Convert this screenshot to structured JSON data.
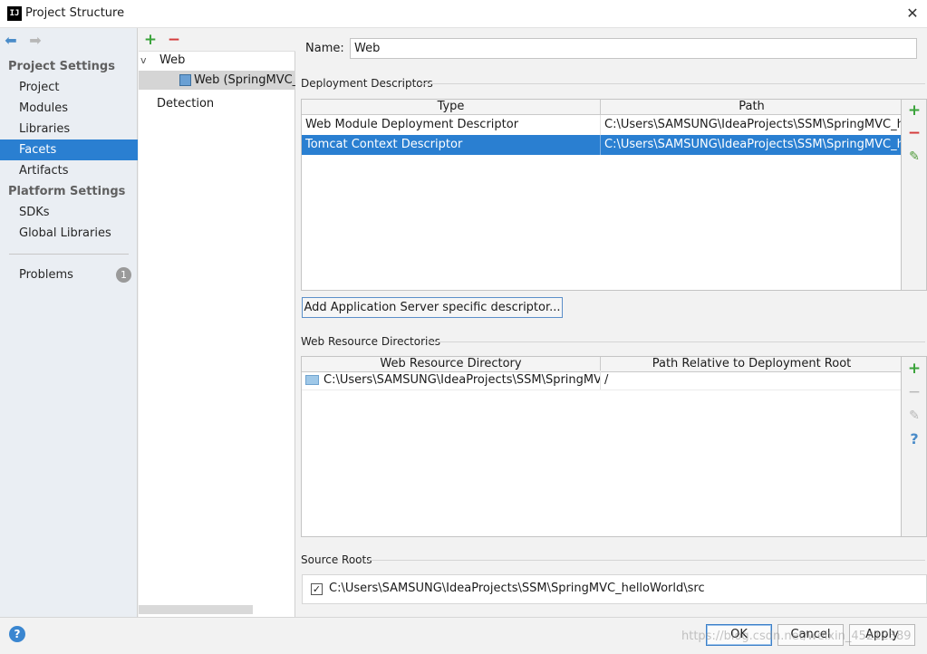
{
  "window": {
    "title": "Project Structure",
    "logo": "IJ",
    "close_glyph": "✕"
  },
  "sidebar": {
    "back_glyph": "⬅",
    "forward_glyph": "➡",
    "project_settings_header": "Project Settings",
    "platform_settings_header": "Platform Settings",
    "items": [
      {
        "label": "Project"
      },
      {
        "label": "Modules"
      },
      {
        "label": "Libraries"
      },
      {
        "label": "Facets",
        "selected": true
      },
      {
        "label": "Artifacts"
      },
      {
        "label": "SDKs"
      },
      {
        "label": "Global Libraries"
      },
      {
        "label": "Problems"
      }
    ],
    "problems_count": "1"
  },
  "tree": {
    "add_glyph": "+",
    "remove_glyph": "−",
    "chevron": "v",
    "root_label": "Web",
    "facet_label": "Web (SpringMVC_h",
    "detection_label": "Detection"
  },
  "main": {
    "name_label": "Name:",
    "name_value": "Web",
    "deployment_descriptors": {
      "title": "Deployment Descriptors",
      "columns": [
        "Type",
        "Path"
      ],
      "rows": [
        {
          "type": "Web Module Deployment Descriptor",
          "path": "C:\\Users\\SAMSUNG\\IdeaProjects\\SSM\\SpringMVC_hello"
        },
        {
          "type": "Tomcat Context Descriptor",
          "path": "C:\\Users\\SAMSUNG\\IdeaProjects\\SSM\\SpringMVC_hello",
          "selected": true
        }
      ],
      "add_descriptor_button": "Add Application Server specific descriptor..."
    },
    "web_resource_directories": {
      "title": "Web Resource Directories",
      "columns": [
        "Web Resource Directory",
        "Path Relative to Deployment Root"
      ],
      "rows": [
        {
          "directory": "C:\\Users\\SAMSUNG\\IdeaProjects\\SSM\\SpringMV...",
          "relative": "/"
        }
      ],
      "help_glyph": "?"
    },
    "source_roots": {
      "title": "Source Roots",
      "checked_glyph": "✓",
      "path": "C:\\Users\\SAMSUNG\\IdeaProjects\\SSM\\SpringMVC_helloWorld\\src"
    },
    "tool_glyphs": {
      "add": "+",
      "remove": "−",
      "edit": "✎"
    }
  },
  "footer": {
    "help_glyph": "?",
    "ok": "OK",
    "cancel": "Cancel",
    "apply": "Apply",
    "watermark": "https://blog.csdn.net/weixin_45212389"
  },
  "colors": {
    "selection": "#2a7fd1",
    "add": "#3ba33b",
    "remove": "#d43b3b",
    "sidebar_bg": "#eaeef3"
  }
}
